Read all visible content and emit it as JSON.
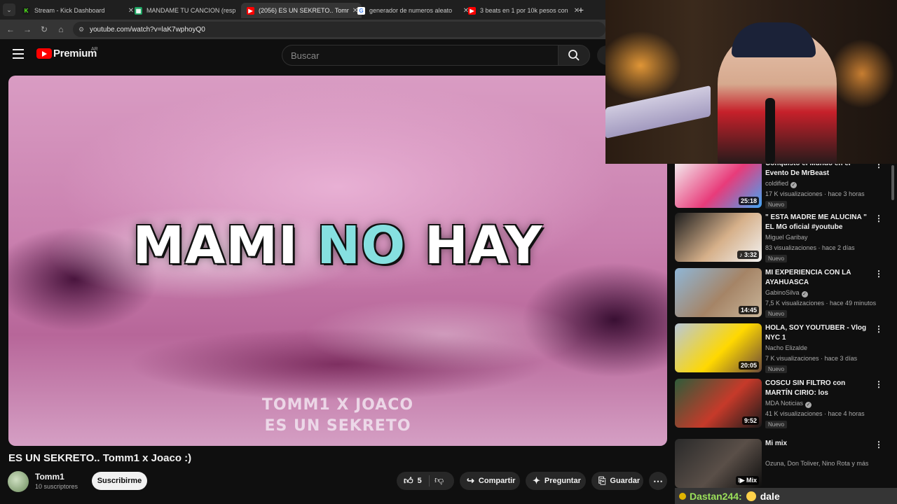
{
  "browser": {
    "tabs": [
      {
        "label": "Stream - Kick Dashboard",
        "fav_color": "#1a1a1a",
        "fav_text_color": "#53fc18",
        "fav_glyph": "K"
      },
      {
        "label": "MANDAME TU CANCION (resp",
        "fav_color": "#1ea362",
        "fav_text_color": "#ffffff",
        "fav_glyph": "▦"
      },
      {
        "label": "(2056) ES UN SEKRETO.. Tomm",
        "fav_color": "#ff0000",
        "fav_text_color": "#ffffff",
        "fav_glyph": "▶",
        "active": true
      },
      {
        "label": "generador de numeros aleato",
        "fav_color": "#ffffff",
        "fav_text_color": "#4285f4",
        "fav_glyph": "G"
      },
      {
        "label": "3 beats en 1 por 10k pesos con",
        "fav_color": "#ff0000",
        "fav_text_color": "#ffffff",
        "fav_glyph": "▶"
      }
    ],
    "close_glyph": "✕",
    "new_tab_glyph": "+",
    "tab_list_glyph": "⌄",
    "url": "youtube.com/watch?v=laK7wphoyQ0"
  },
  "youtube": {
    "logo_text": "Premium",
    "region": "AR",
    "search_placeholder": "Buscar",
    "video": {
      "overlay_word1": "MAMI ",
      "overlay_word2": "NO",
      "overlay_word3": " HAY",
      "credit_line1": "TOMM1 X JOACO",
      "credit_line2": "ES UN SEKRETO"
    },
    "title": "ES UN SEKRETO.. Tomm1 x Joaco :)",
    "channel": {
      "name": "Tomm1",
      "subscribers": "10 suscriptores"
    },
    "subscribe_label": "Suscribirme",
    "actions": {
      "likes": "5",
      "share": "Compartir",
      "ask": "Preguntar",
      "save": "Guardar",
      "more": "⋯"
    }
  },
  "recommendations": [
    {
      "title": "Conquisto el Mundo en el Evento De MrBeast",
      "channel": "coldified",
      "verified": true,
      "meta": "17 K visualizaciones · hace 3 horas",
      "badge": "Nuevo",
      "duration": "25:18",
      "thumb": [
        "#f4f4f4",
        "#e83b7a",
        "#42a5f5"
      ]
    },
    {
      "title": "\" ESTA MADRE ME ALUCINA \" EL MG oficial #youtube #hiphop",
      "channel": "Miguel Garibay",
      "verified": false,
      "meta": "83 visualizaciones · hace 2 días",
      "badge": "Nuevo",
      "duration": "♪ 3:32",
      "thumb": [
        "#1d1d1d",
        "#d6b08a",
        "#f2f2f2"
      ]
    },
    {
      "title": "MI EXPERIENCIA CON LA AYAHUASCA",
      "channel": "GabinoSilva",
      "verified": true,
      "meta": "7,5 K visualizaciones · hace 49 minutos",
      "badge": "Nuevo",
      "duration": "14:45",
      "thumb": [
        "#8fb6d6",
        "#a58466",
        "#c9b59a"
      ]
    },
    {
      "title": "HOLA, SOY YOUTUBER - Vlog NYC 1",
      "channel": "Nacho Elizalde",
      "verified": false,
      "meta": "7 K visualizaciones · hace 3 días",
      "badge": "Nuevo",
      "duration": "20:05",
      "thumb": [
        "#b9c8d8",
        "#ffd800",
        "#6b4a3a"
      ]
    },
    {
      "title": "COSCU SIN FILTRO con MARTÍN CIRIO: los POLÉMICOS CA...",
      "channel": "MDA Noticias",
      "verified": true,
      "meta": "41 K visualizaciones · hace 4 horas",
      "badge": "Nuevo",
      "duration": "9:52",
      "thumb": [
        "#2f5c3a",
        "#c63a2a",
        "#1a1a1a"
      ]
    },
    {
      "title": "Mi mix",
      "channel": "Ozuna, Don Toliver, Nino Rota y más",
      "verified": false,
      "meta": "",
      "badge": "",
      "duration": "⁝▶ Mix",
      "thumb": [
        "#2a2a2a",
        "#5a4f48",
        "#0d0d0d"
      ]
    }
  ],
  "chat": {
    "user": "Dastan244",
    "separator": ":",
    "message": "dale"
  }
}
